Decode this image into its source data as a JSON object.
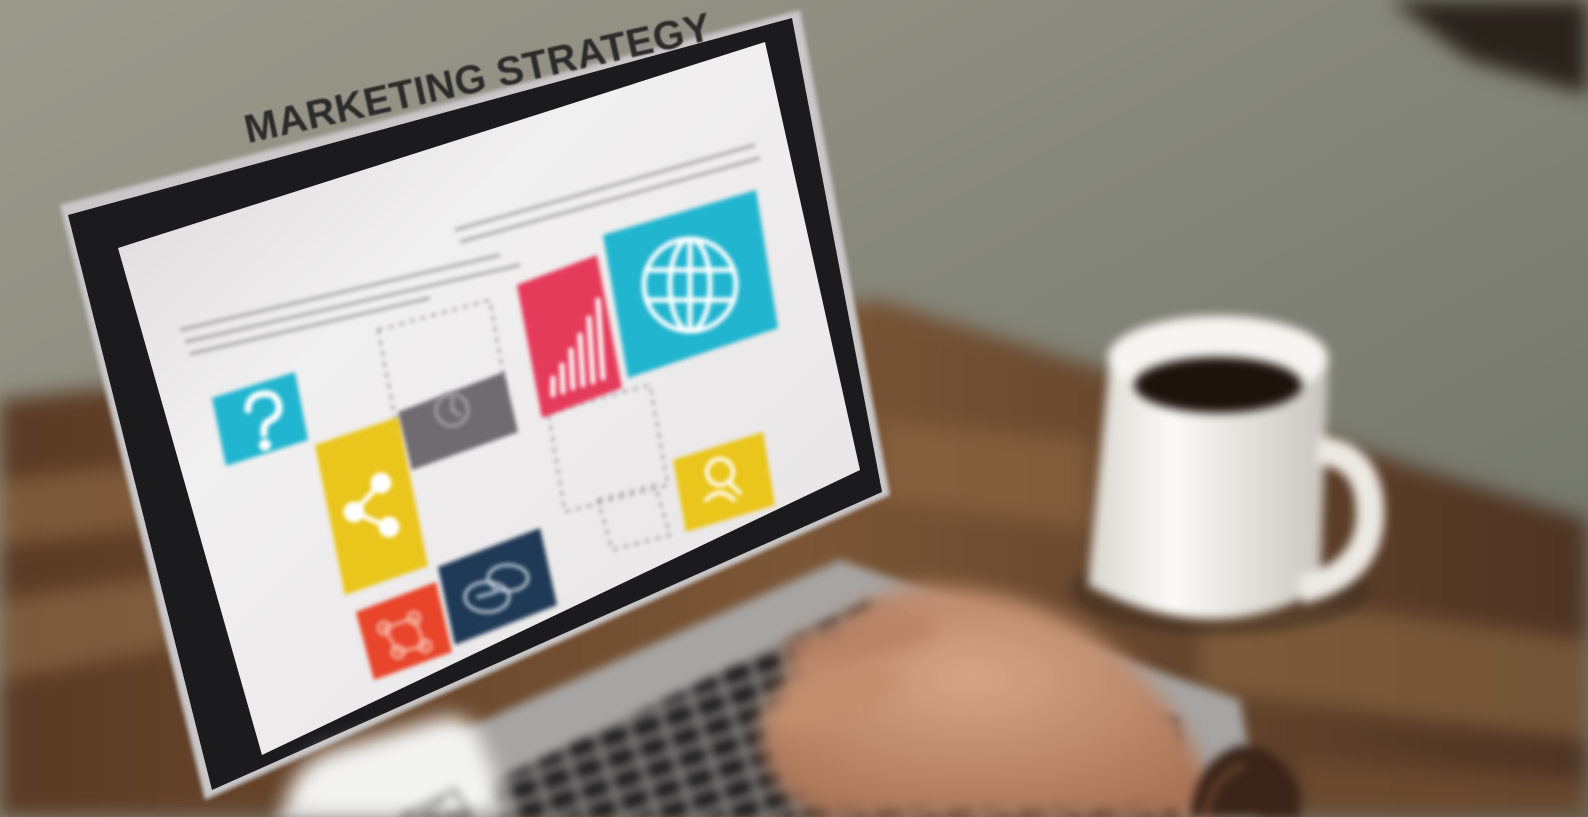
{
  "scene": {
    "screen_title": "MARKETING STRATEGY",
    "tile_icons": [
      "question-icon",
      "share-icon",
      "globe-icon",
      "bar-chart-icon",
      "target-icon",
      "chat-icon",
      "network-icon",
      "search-user-icon"
    ],
    "colors": {
      "wall": "#7d7e72",
      "table": "#6d4a30",
      "laptop_bezel": "#1b1b1d",
      "screen": "#ebe9ea",
      "tile_cyan": "#21b5cf",
      "tile_yellow": "#eac51b",
      "tile_red": "#e53b5b",
      "tile_gray": "#6f6b70",
      "tile_orange": "#e8452a",
      "tile_navy": "#1f3a56",
      "coffee": "#1e120c",
      "mug": "#f4f3ef"
    }
  }
}
